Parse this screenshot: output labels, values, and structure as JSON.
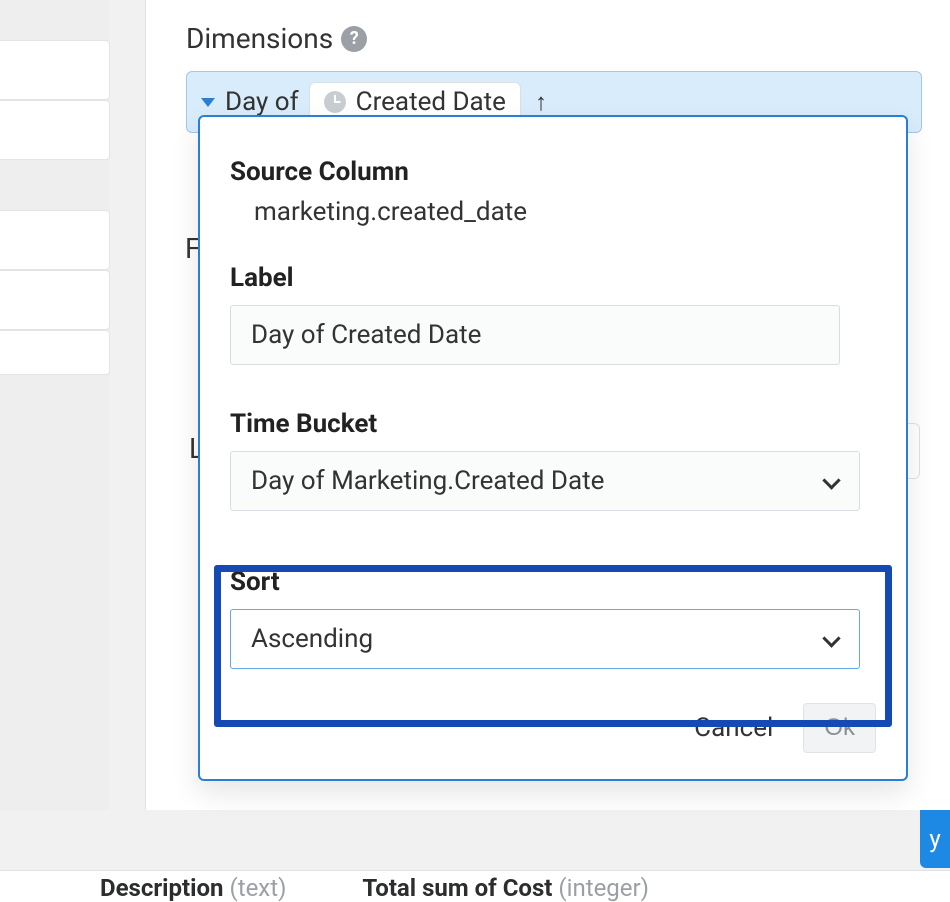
{
  "dimensions": {
    "header": "Dimensions",
    "chip": {
      "prefix": "Day of",
      "created_label": "Created Date",
      "sort_glyph": "↑"
    }
  },
  "bg": {
    "f_letter": "F",
    "l_letter": "L"
  },
  "popover": {
    "source_column": {
      "title": "Source Column",
      "value": "marketing.created_date"
    },
    "label": {
      "title": "Label",
      "value": "Day of Created Date"
    },
    "time_bucket": {
      "title": "Time Bucket",
      "value": "Day of Marketing.Created Date"
    },
    "sort": {
      "title": "Sort",
      "value": "Ascending"
    },
    "cancel": "Cancel",
    "ok": "Ok"
  },
  "primary_button_fragment": "y",
  "footer": {
    "desc_label": "Description",
    "desc_type": "(text)",
    "total_label": "Total sum of Cost",
    "total_type": "(integer)"
  }
}
